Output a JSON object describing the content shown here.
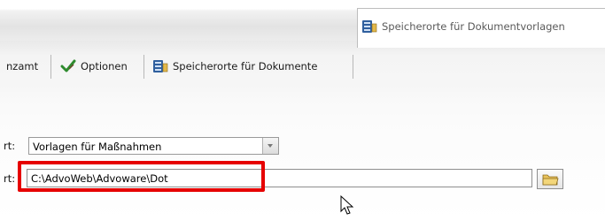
{
  "tabs": [
    {
      "label": "nzamt",
      "icon": "none"
    },
    {
      "label": "Optionen",
      "icon": "checkmark-pen-icon"
    },
    {
      "label": "Speicherorte für Dokumente",
      "icon": "database-folder-icon"
    },
    {
      "label": "Speicherorte für Dokumentvorlagen",
      "icon": "database-folder-icon"
    }
  ],
  "form": {
    "row1_label": "rt:",
    "template_type_value": "Vorlagen für Maßnahmen",
    "row2_label": "rt:",
    "path_value": "C:\\AdvoWeb\\Advoware\\Dot"
  },
  "colors": {
    "highlight": "#e60000",
    "active_tab_text": "#5a5a5a"
  }
}
